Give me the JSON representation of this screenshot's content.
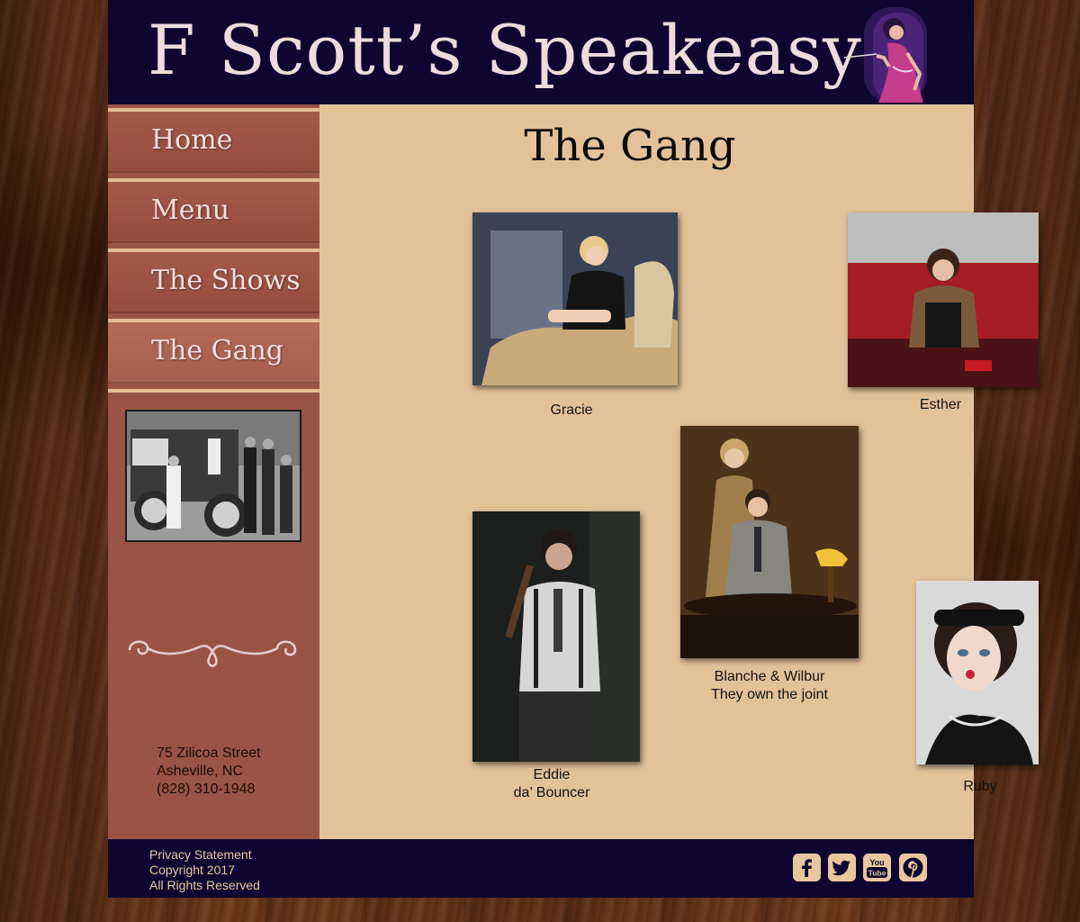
{
  "header": {
    "site_title": "F Scott’s Speakeasy"
  },
  "nav": {
    "items": [
      {
        "label": "Home"
      },
      {
        "label": "Menu"
      },
      {
        "label": "The Shows"
      },
      {
        "label": "The Gang"
      }
    ],
    "active": "The Gang"
  },
  "sidebar": {
    "address": {
      "street": "75 Zilicoa Street",
      "city": "Asheville, NC",
      "phone": "(828) 310-1948"
    }
  },
  "main": {
    "title": "The Gang",
    "members": [
      {
        "caption_line1": "Gracie",
        "caption_line2": ""
      },
      {
        "caption_line1": "Esther",
        "caption_line2": ""
      },
      {
        "caption_line1": "Blanche & Wilbur",
        "caption_line2": "They own the joint"
      },
      {
        "caption_line1": "Eddie",
        "caption_line2": "da’ Bouncer"
      },
      {
        "caption_line1": "Ruby",
        "caption_line2": ""
      }
    ]
  },
  "footer": {
    "privacy": "Privacy Statement",
    "copyright": "Copyright 2017",
    "rights": "All Rights Reserved",
    "social_icons": [
      "facebook-icon",
      "twitter-icon",
      "youtube-icon",
      "pinterest-icon"
    ]
  },
  "colors": {
    "header_bg": "#0e0530",
    "sidebar_bg": "#9a5445",
    "content_bg": "#e3c29a",
    "nav_text": "#f3dede",
    "footer_text": "#e6c9a0"
  }
}
